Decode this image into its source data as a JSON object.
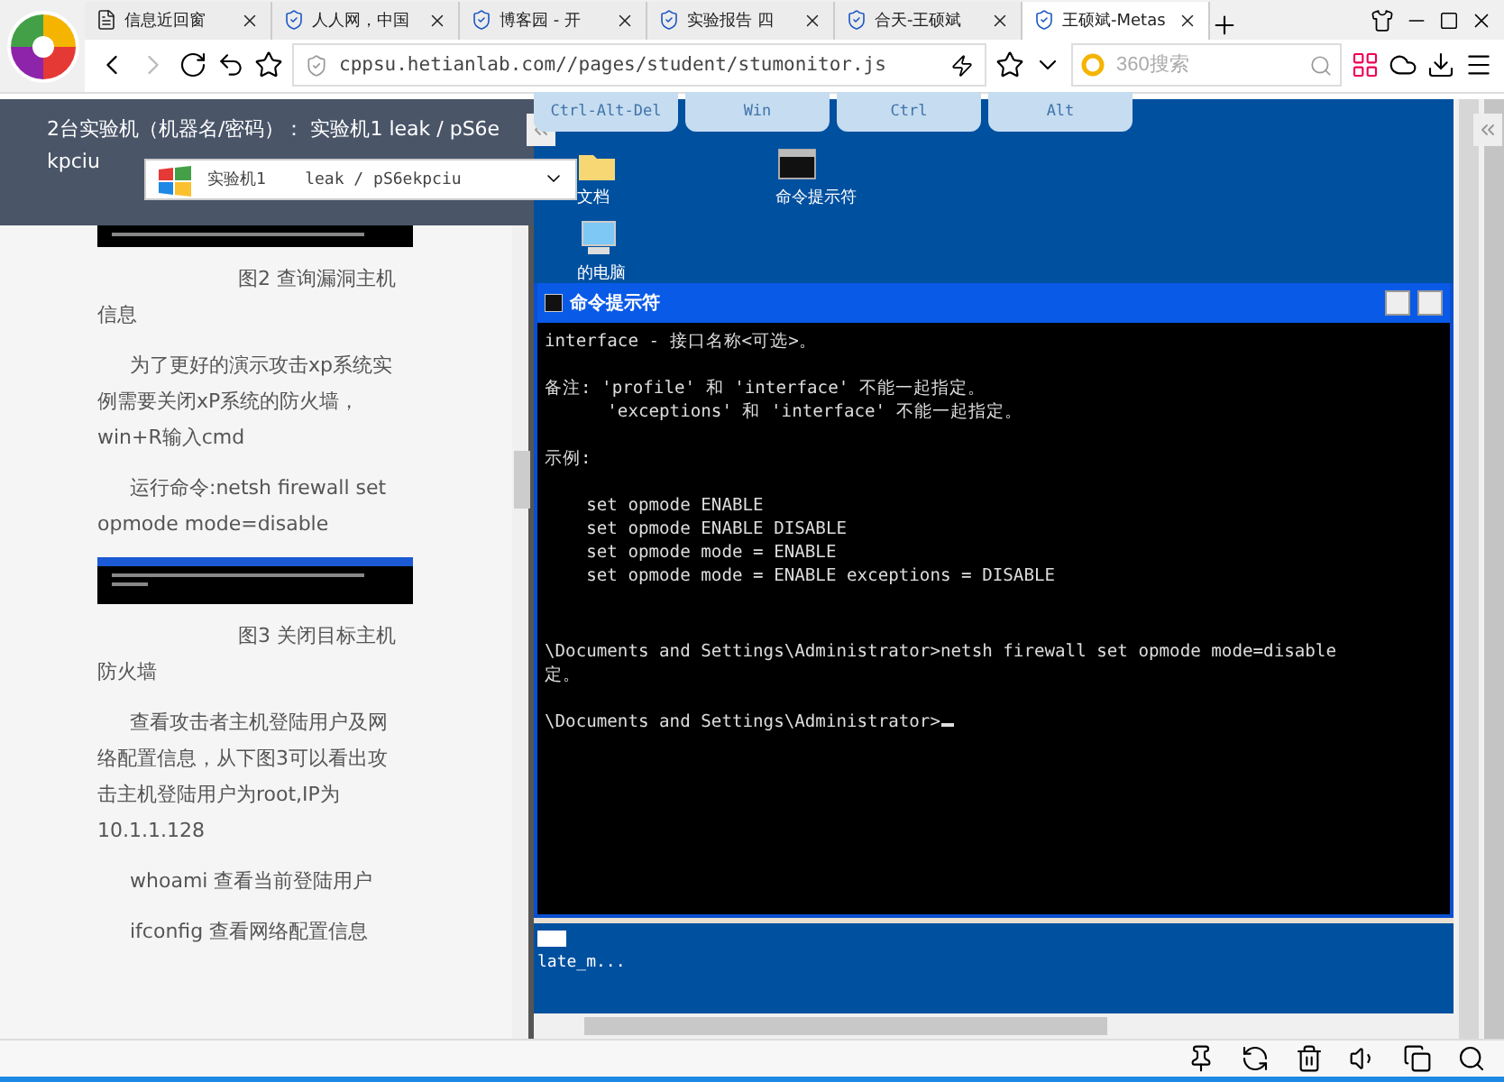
{
  "tabs": [
    {
      "label": "信息近回窗",
      "selected": false
    },
    {
      "label": "人人网，中国",
      "selected": false
    },
    {
      "label": "博客园 - 开",
      "selected": false
    },
    {
      "label": "实验报告 四",
      "selected": false
    },
    {
      "label": "合天-王硕斌",
      "selected": false
    },
    {
      "label": "王硕斌-Metas",
      "selected": true
    }
  ],
  "address_bar": {
    "url": "cppsu.hetianlab.com//pages/student/stumonitor.js",
    "search_placeholder": "360搜索"
  },
  "lab_panel": {
    "header": [
      "2台实验机（机器名/密码）：  实验机1    leak / pS6e",
      "kpciu"
    ],
    "machine_select": {
      "name": "实验机1",
      "credentials": "leak / pS6ekpciu"
    }
  },
  "article": [
    {
      "kind": "picture"
    },
    {
      "kind": "caption",
      "text": "图2 查询漏洞主机信息"
    },
    {
      "kind": "text",
      "text": "为了更好的演示攻击xp系统实例需要关闭xP系统的防火墙，win+R输入cmd"
    },
    {
      "kind": "text",
      "text": "运行命令:netsh firewall set opmode mode=disable"
    },
    {
      "kind": "picture"
    },
    {
      "kind": "caption",
      "text": "图3 关闭目标主机防火墙"
    },
    {
      "kind": "text",
      "text": "查看攻击者主机登陆用户及网络配置信息，从下图3可以看出攻击主机登陆用户为root,IP为10.1.1.128"
    },
    {
      "kind": "text",
      "text": "whoami  查看当前登陆用户"
    },
    {
      "kind": "text",
      "text": "ifconfig 查看网络配置信息"
    }
  ],
  "remote_keys": [
    "Ctrl-Alt-Del",
    "Win",
    "Ctrl",
    "Alt"
  ],
  "desktop_icons": [
    {
      "label": "文档",
      "kind": "folder"
    },
    {
      "label": "命令提示符",
      "kind": "console"
    },
    {
      "label": "的电脑",
      "kind": "computer"
    }
  ],
  "cmd_window": {
    "title": "命令提示符",
    "blocks": [
      [
        "interface - 接口名称<可选>。"
      ],
      [
        "备注: 'profile' 和 'interface' 不能一起指定。",
        "      'exceptions' 和 'interface' 不能一起指定。"
      ],
      [
        "示例:"
      ],
      [
        "    set opmode ENABLE",
        "    set opmode ENABLE DISABLE",
        "    set opmode mode = ENABLE",
        "    set opmode mode = ENABLE exceptions = DISABLE"
      ],
      [
        "\\Documents and Settings\\Administrator>netsh firewall set opmode mode=disable",
        "定。"
      ],
      [
        "\\Documents and Settings\\Administrator>"
      ]
    ]
  },
  "taskbar_item": "late_m..."
}
